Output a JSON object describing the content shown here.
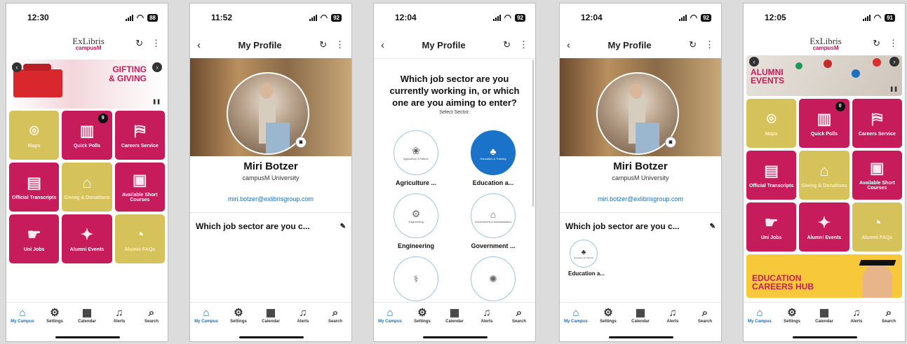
{
  "tabs": [
    "My Campus",
    "Settings",
    "Calendar",
    "Alerts",
    "Search"
  ],
  "tab_icons": [
    "home-icon",
    "gear-icon",
    "calendar-icon",
    "bell-icon",
    "search-icon"
  ],
  "logo": {
    "ex": "ExLibris",
    "cm": "campusM"
  },
  "s1": {
    "time": "12:30",
    "battery": "88",
    "banner": "GIFTING & GIVING",
    "tiles": [
      {
        "label": "Maps",
        "color": "y"
      },
      {
        "label": "Quick Polls",
        "color": "m",
        "badge": "9"
      },
      {
        "label": "Careers Service",
        "color": "m"
      },
      {
        "label": "Official Transcripts",
        "color": "m"
      },
      {
        "label": "Giving & Donations",
        "color": "y"
      },
      {
        "label": "Available Short Courses",
        "color": "m"
      },
      {
        "label": "Uni Jobs",
        "color": "m"
      },
      {
        "label": "Alumni Events",
        "color": "m"
      },
      {
        "label": "Alumni FAQs",
        "color": "y"
      }
    ]
  },
  "s2": {
    "time": "11:52",
    "battery": "92",
    "title": "My Profile",
    "name": "Miri Botzer",
    "uni": "campusM University",
    "email": "miri.botzer@exlibrisgroup.com",
    "section": "Which job sector are you c..."
  },
  "s3": {
    "time": "12:04",
    "battery": "92",
    "title": "My Profile",
    "question": "Which job sector are you currently working in, or which one are you aiming to enter?",
    "select": "Select Sector:",
    "sectors": [
      {
        "label": "Agriculture ...",
        "inner": "Agriculture & Nature",
        "selected": false
      },
      {
        "label": "Education a...",
        "inner": "Education & Training",
        "selected": true
      },
      {
        "label": "Engineering",
        "inner": "Engineering",
        "selected": false
      },
      {
        "label": "Government ...",
        "inner": "Government & Administration",
        "selected": false
      }
    ]
  },
  "s4": {
    "time": "12:04",
    "battery": "92",
    "title": "My Profile",
    "name": "Miri Botzer",
    "uni": "campusM University",
    "email": "miri.botzer@exlibrisgroup.com",
    "section": "Which job sector are you c...",
    "chosen": "Education a...",
    "chosen_inner": "Education & Training"
  },
  "s5": {
    "time": "12:05",
    "battery": "91",
    "banner": "ALUMNI EVENTS",
    "tiles": [
      {
        "label": "Maps",
        "color": "y"
      },
      {
        "label": "Quick Polls",
        "color": "m",
        "badge": "0"
      },
      {
        "label": "Careers Service",
        "color": "m"
      },
      {
        "label": "Official Transcripts",
        "color": "m"
      },
      {
        "label": "Giving & Donations",
        "color": "y"
      },
      {
        "label": "Available Short Courses",
        "color": "m"
      },
      {
        "label": "Uni Jobs",
        "color": "m"
      },
      {
        "label": "Alumni Events",
        "color": "m"
      },
      {
        "label": "Alumni FAQs",
        "color": "y"
      }
    ],
    "hub": "EDUCATION CAREERS HUB"
  }
}
